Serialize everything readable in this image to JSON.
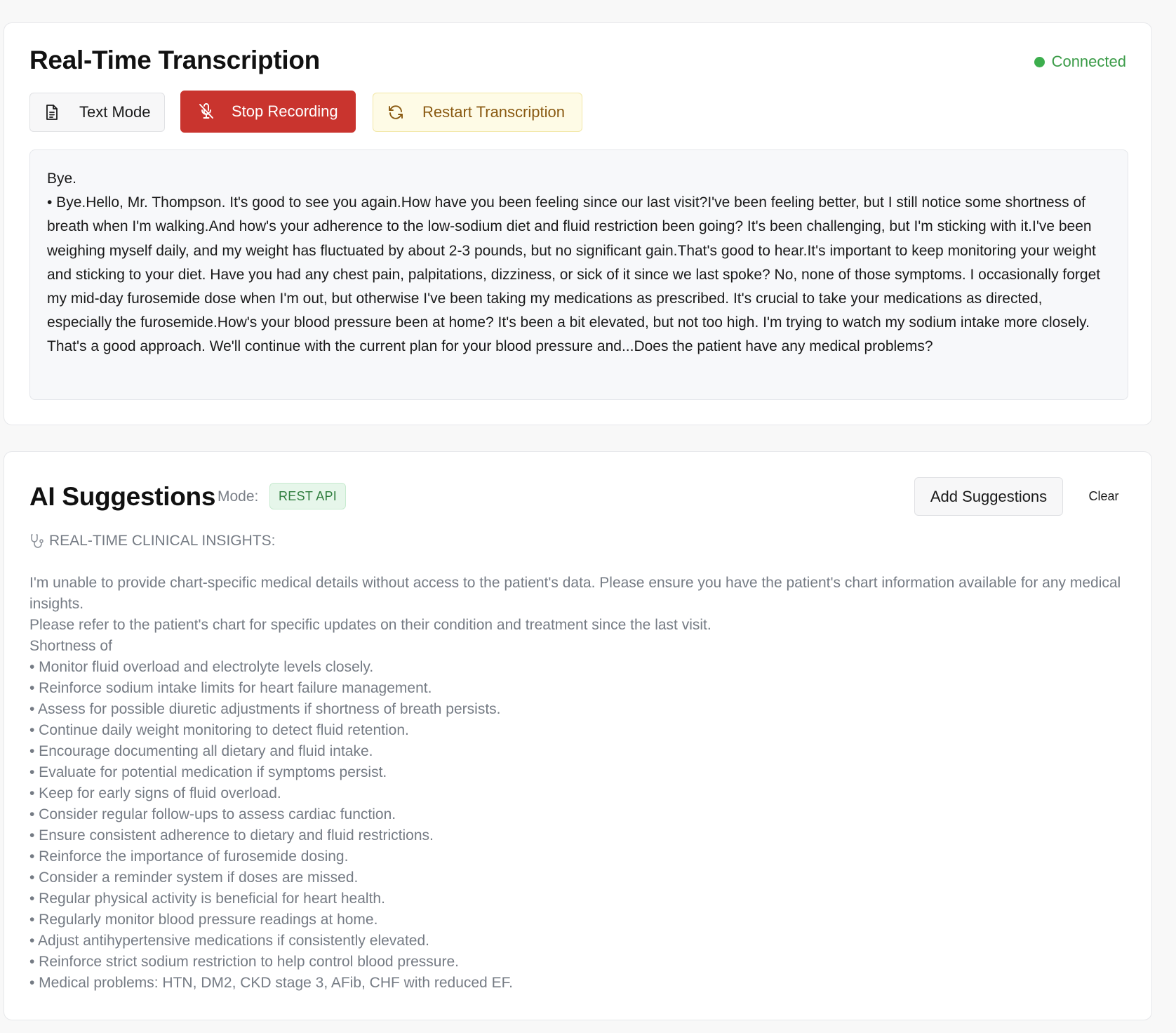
{
  "transcription": {
    "title": "Real-Time Transcription",
    "status": "Connected",
    "buttons": {
      "text_mode": "Text Mode",
      "stop_recording": "Stop Recording",
      "restart": "Restart Transcription"
    },
    "transcript_line1": "Bye.",
    "transcript_body": "• Bye.Hello, Mr. Thompson. It's good to see you again.How have you been feeling since our last visit?I've been feeling better, but I still notice some shortness of breath when I'm walking.And how's your adherence to the low-sodium diet and fluid restriction been going? It's been challenging, but I'm sticking with it.I've been weighing myself daily, and my weight has fluctuated by about 2-3 pounds, but no significant gain.That's good to hear.It's important to keep monitoring your weight and sticking to your diet. Have you had any chest pain, palpitations, dizziness, or sick of it since we last spoke? No, none of those symptoms. I occasionally forget my mid-day furosemide dose when I'm out, but otherwise I've been taking my medications as prescribed. It's crucial to take your medications as directed, especially the furosemide.How's your blood pressure been at home? It's been a bit elevated, but not too high. I'm trying to watch my sodium intake more closely. That's a good approach. We'll continue with the current plan for your blood pressure and...Does the patient have any medical problems?"
  },
  "ai": {
    "title": "AI Suggestions",
    "mode_label": "Mode:",
    "mode_value": "REST API",
    "add_button": "Add Suggestions",
    "clear_button": "Clear",
    "insights_heading": "REAL-TIME CLINICAL INSIGHTS:",
    "paragraph1": "I'm unable to provide chart-specific medical details without access to the patient's data. Please ensure you have the patient's chart information available for any medical insights.",
    "paragraph2": "Please refer to the patient's chart for specific updates on their condition and treatment since the last visit.",
    "paragraph3": "Shortness of",
    "bullets": [
      "• Monitor fluid overload and electrolyte levels closely.",
      "• Reinforce sodium intake limits for heart failure management.",
      "• Assess for possible diuretic adjustments if shortness of breath persists.",
      "• Continue daily weight monitoring to detect fluid retention.",
      "• Encourage documenting all dietary and fluid intake.",
      "• Evaluate for potential medication if symptoms persist.",
      "• Keep for early signs of fluid overload.",
      "• Consider regular follow-ups to assess cardiac function.",
      "• Ensure consistent adherence to dietary and fluid restrictions.",
      "• Reinforce the importance of furosemide dosing.",
      "• Consider a reminder system if doses are missed.",
      "• Regular physical activity is beneficial for heart health.",
      "• Regularly monitor blood pressure readings at home.",
      "• Adjust antihypertensive medications if consistently elevated.",
      "• Reinforce strict sodium restriction to help control blood pressure.",
      "• Medical problems: HTN, DM2, CKD stage 3, AFib, CHF with reduced EF."
    ]
  },
  "icons": {
    "text_mode": "document-icon",
    "stop_recording": "mic-off-icon",
    "restart": "refresh-icon",
    "status": "status-dot",
    "insights": "stethoscope-icon"
  },
  "colors": {
    "stop_button": "#c9342e",
    "restart_button_bg": "#fefbe6",
    "restart_button_text": "#8a5a12",
    "status_connected": "#3a9b47",
    "mode_badge_bg": "#e6f6ea",
    "mode_badge_text": "#2f7d3d"
  }
}
